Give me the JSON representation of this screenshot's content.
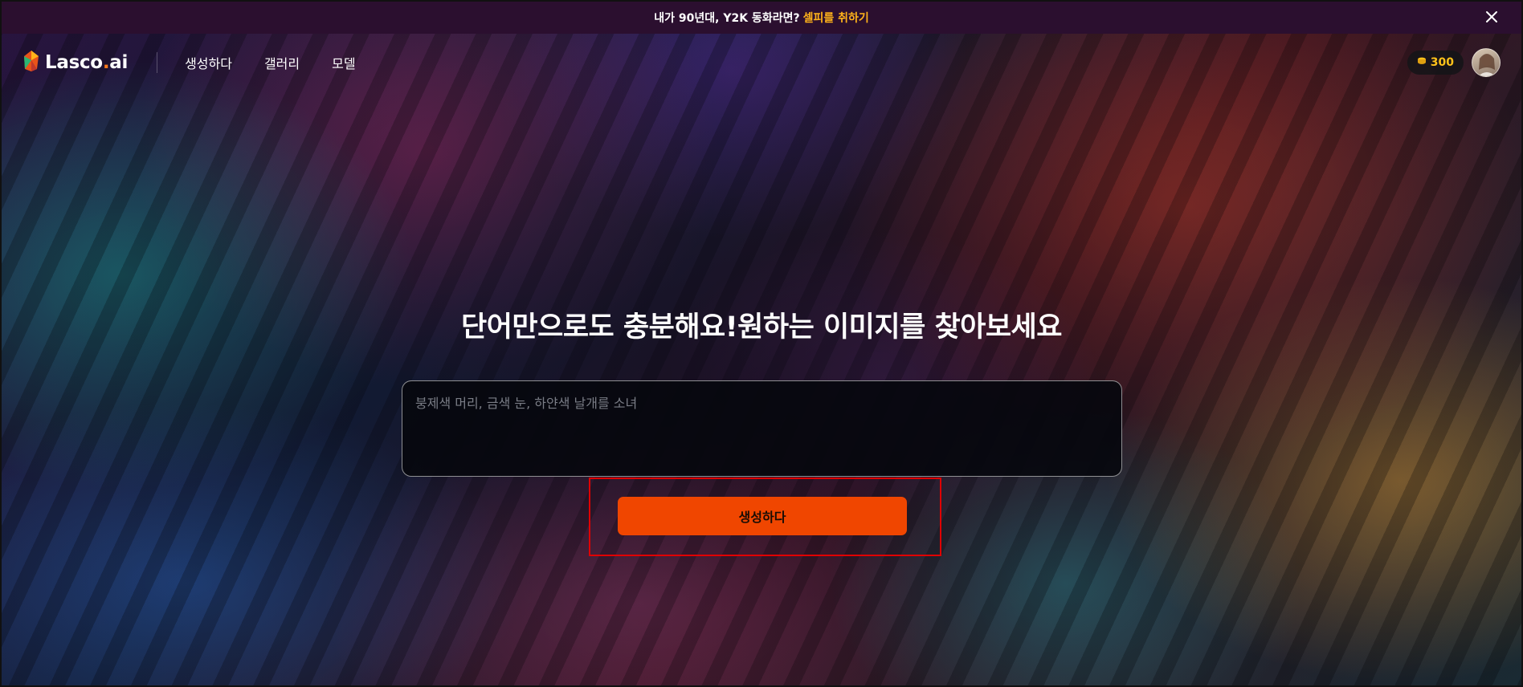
{
  "banner": {
    "text": "내가 90년대, Y2K 동화라면?",
    "highlight": "셀피를 취하기",
    "highlight_color": "#ffb31a"
  },
  "nav": {
    "logo": "Lasco",
    "logo_dot": ".",
    "logo_suffix": "ai",
    "links": [
      "생성하다",
      "갤러리",
      "모델"
    ],
    "credits": "300"
  },
  "hero": {
    "title": "단어만으로도 충분해요!원하는 이미지를 찾아보세요",
    "prompt_placeholder": "붕제색 머리, 금색 눈, 하얀색 날개를 소녀",
    "prompt_value": "",
    "generate_label": "생성하다"
  },
  "colors": {
    "accent": "#f04600",
    "coin": "#ffc21a",
    "banner_bg": "#2b0f2f"
  }
}
